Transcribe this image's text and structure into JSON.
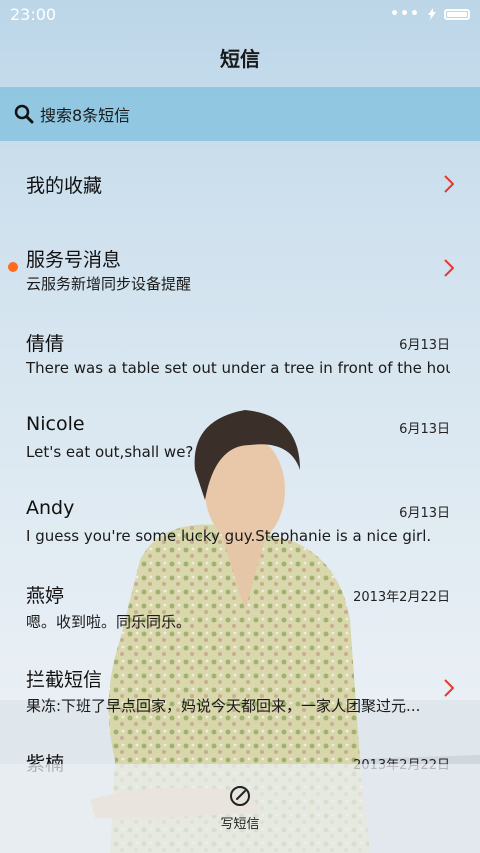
{
  "status_bar": {
    "time": "23:00",
    "dots": "•••"
  },
  "header": {
    "title": "短信"
  },
  "search": {
    "label": "搜索8条短信"
  },
  "items": [
    {
      "name": "我的收藏",
      "preview": "",
      "date": "",
      "has_arrow": true,
      "unread": false
    },
    {
      "name": "服务号消息",
      "preview": "云服务新增同步设备提醒",
      "date": "",
      "has_arrow": true,
      "unread": true
    },
    {
      "name": "倩倩",
      "preview": "There was a table set out under a tree in front of the hous",
      "date": "6月13日",
      "has_arrow": false,
      "unread": false
    },
    {
      "name": "Nicole",
      "preview": "Let's eat out,shall we?",
      "date": "6月13日",
      "has_arrow": false,
      "unread": false
    },
    {
      "name": "Andy",
      "preview": "I guess you're some lucky guy.Stephanie is a nice girl.",
      "date": "6月13日",
      "has_arrow": false,
      "unread": false
    },
    {
      "name": "燕婷",
      "preview": "嗯。收到啦。同乐同乐。",
      "date": "2013年2月22日",
      "has_arrow": false,
      "unread": false
    },
    {
      "name": "拦截短信",
      "preview": "果冻:下班了早点回家，妈说今天都回来，一家人团聚过元...",
      "date": "",
      "has_arrow": true,
      "unread": false
    },
    {
      "name": "紫楠",
      "preview": "",
      "date": "2013年2月22日",
      "has_arrow": false,
      "unread": false
    }
  ],
  "compose": {
    "label": "写短信"
  },
  "colors": {
    "accent": "#e8372e",
    "unread_dot": "#ff6a1f",
    "search_bg": "#87c3de"
  }
}
